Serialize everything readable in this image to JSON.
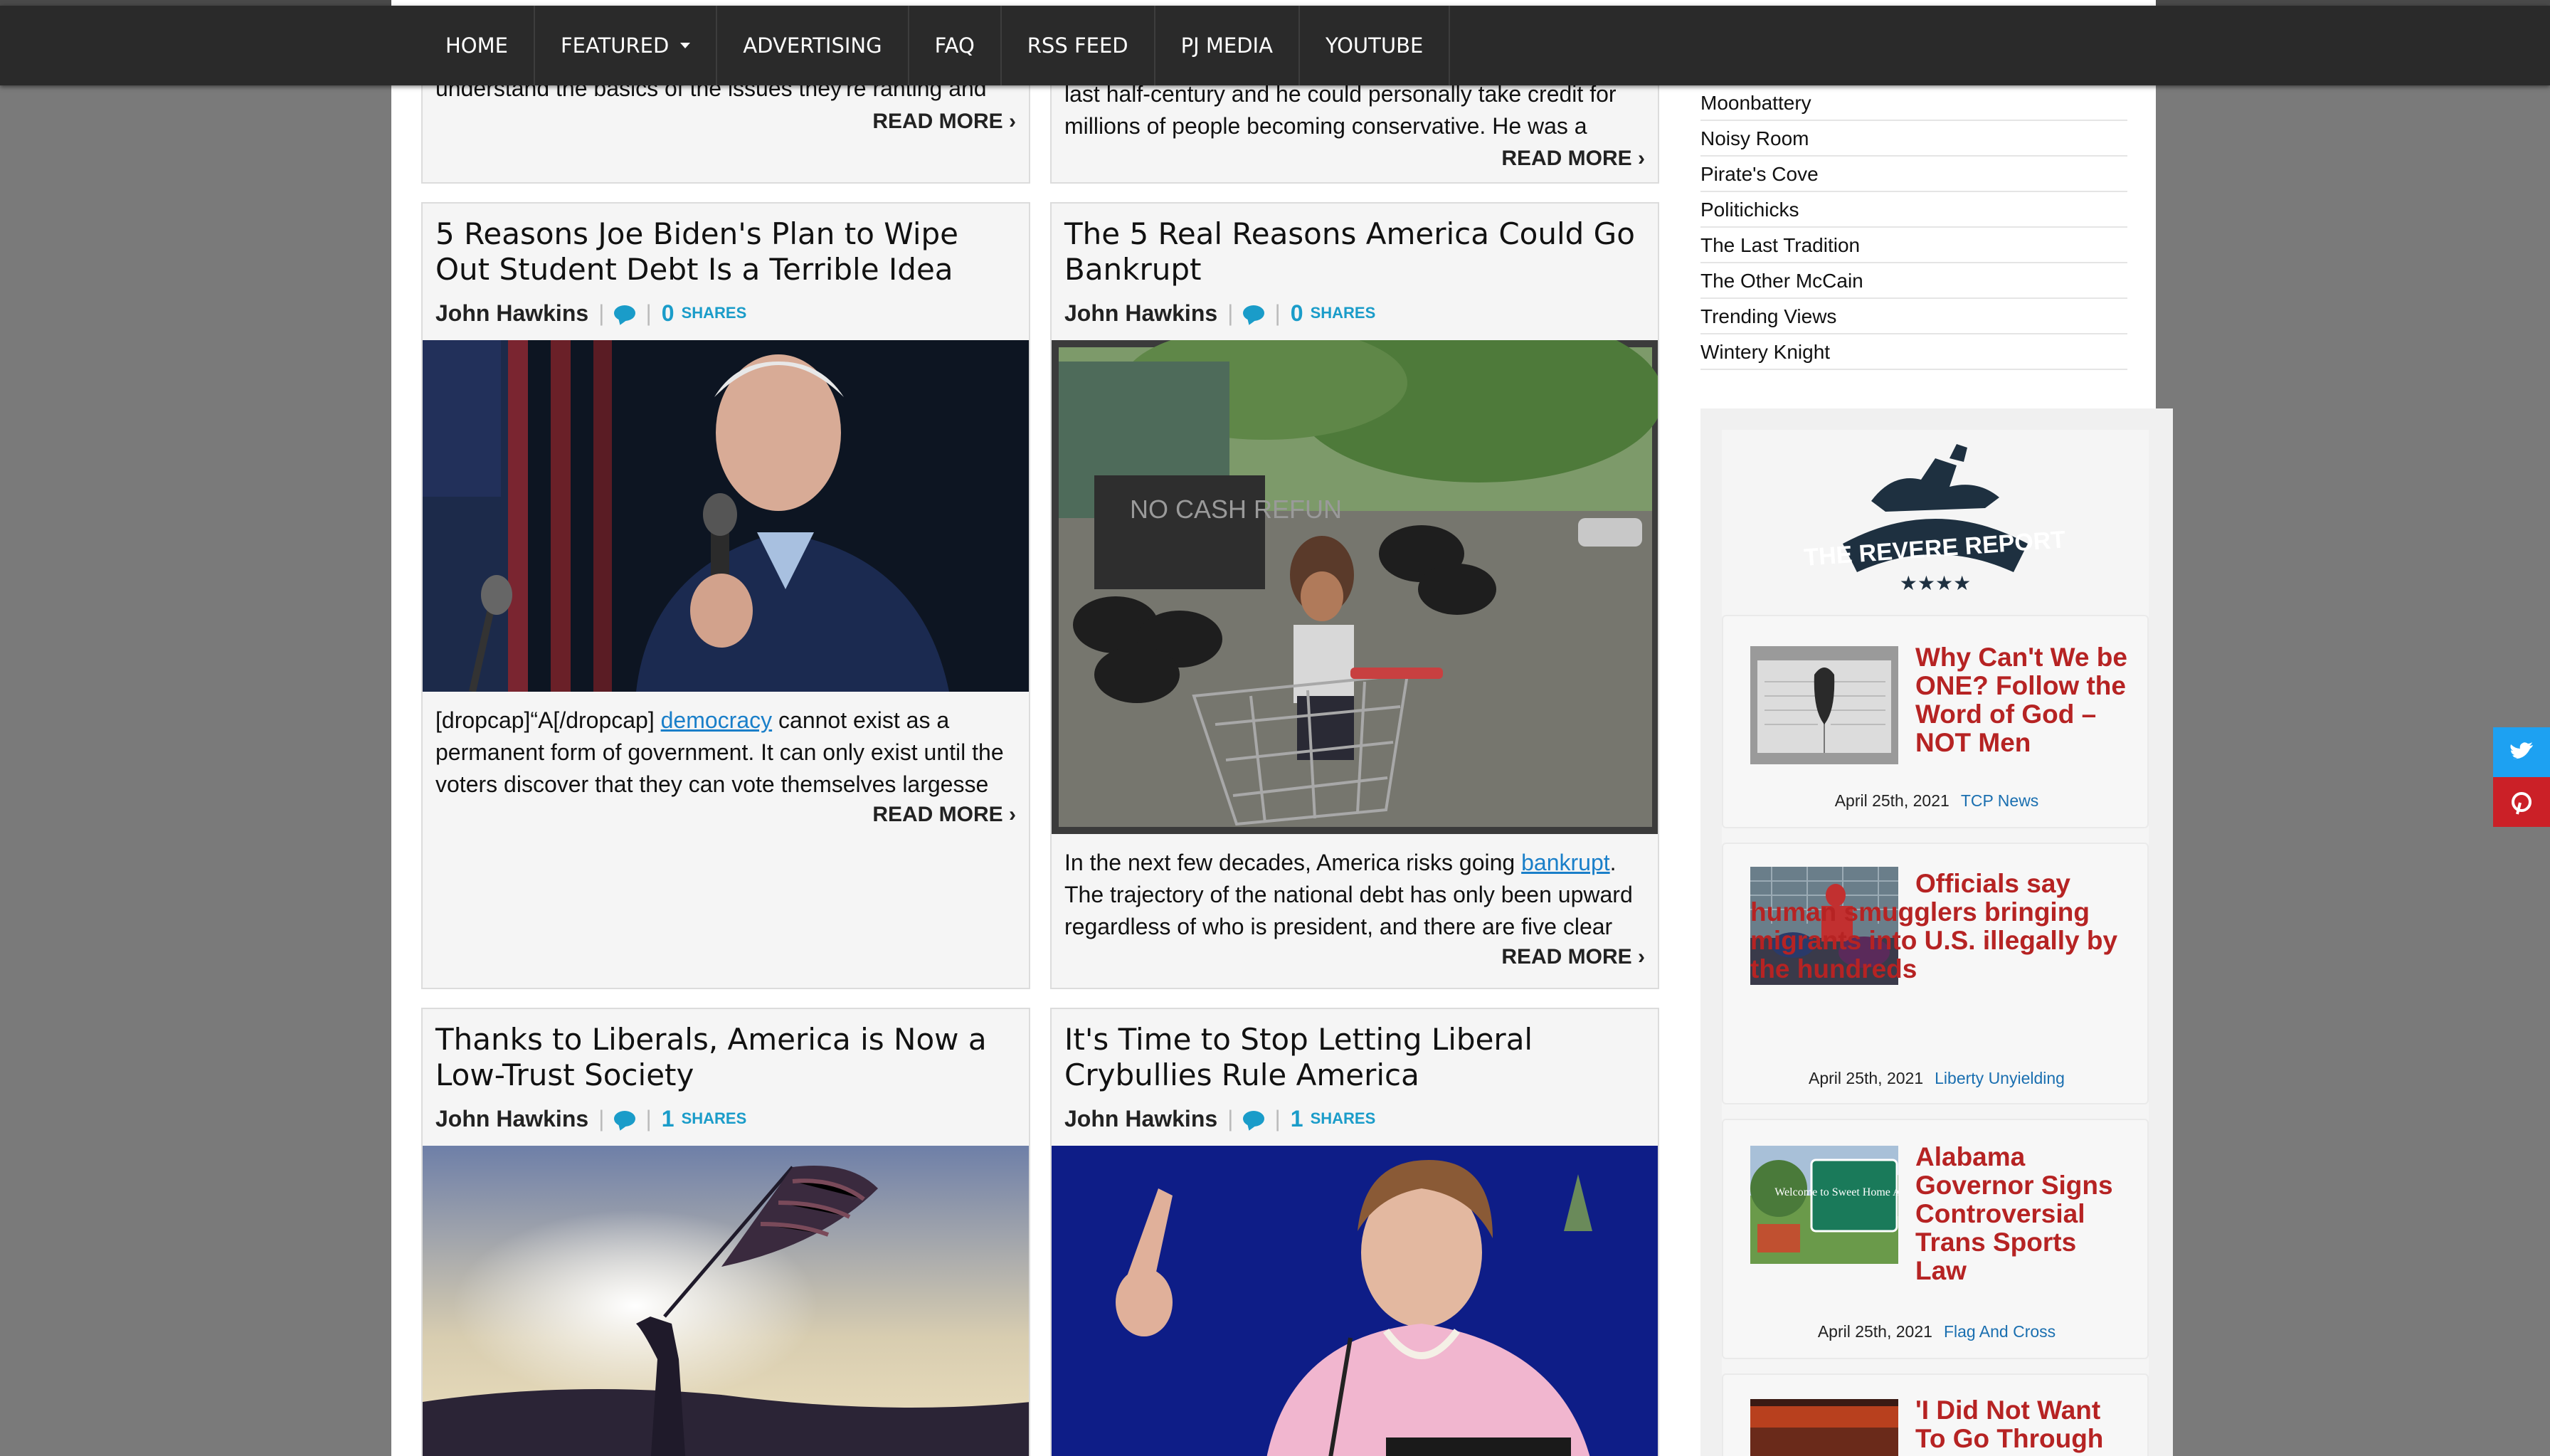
{
  "nav": {
    "items": [
      {
        "label": "HOME"
      },
      {
        "label": "FEATURED"
      },
      {
        "label": "ADVERTISING"
      },
      {
        "label": "FAQ"
      },
      {
        "label": "RSS FEED"
      },
      {
        "label": "PJ MEDIA"
      },
      {
        "label": "YOUTUBE"
      }
    ]
  },
  "posts": {
    "top_left": {
      "excerpt_fragment": "understand the basics of the issues they're ranting and",
      "read_more": "READ MORE"
    },
    "top_right": {
      "excerpt_line1": "last half-century and he could personally take credit for",
      "excerpt_line2": "millions of people becoming conservative. He was a",
      "read_more": "READ MORE"
    },
    "p1": {
      "title": "5 Reasons Joe Biden's Plan to Wipe Out Student Debt Is a Terrible Idea",
      "author": "John Hawkins",
      "share_count": "0",
      "shares_label": "SHARES",
      "excerpt_pre": "[dropcap]“A[/dropcap] ",
      "excerpt_link": "democracy",
      "excerpt_post": " cannot exist as a permanent form of government. It can only exist until the voters discover that they can vote themselves largesse",
      "read_more": "READ MORE"
    },
    "p2": {
      "title": "The 5 Real Reasons America Could Go Bankrupt",
      "author": "John Hawkins",
      "share_count": "0",
      "shares_label": "SHARES",
      "excerpt_pre": "In the next few decades, America risks going ",
      "excerpt_link": "bankrupt",
      "excerpt_post": ". The trajectory of the national debt has only been upward regardless of who is president, and there are five clear",
      "read_more": "READ MORE",
      "image_sign_text": "NO CASH REFUN"
    },
    "p3": {
      "title": "Thanks to Liberals, America is Now a Low-Trust Society",
      "author": "John Hawkins",
      "share_count": "1",
      "shares_label": "SHARES"
    },
    "p4": {
      "title": "It's Time to Stop Letting Liberal Crybullies Rule America",
      "author": "John Hawkins",
      "share_count": "1",
      "shares_label": "SHARES"
    }
  },
  "sidebar": {
    "links": [
      "Moonbattery",
      "Noisy Room",
      "Pirate's Cove",
      "Politichicks",
      "The Last Tradition",
      "The Other McCain",
      "Trending Views",
      "Wintery Knight"
    ]
  },
  "revere": {
    "logo_text": "THE REVERE REPORT",
    "logo_stars": "★★★★",
    "items": [
      {
        "title": "Why Can't We be ONE? Follow the Word of God – NOT Men",
        "date": "April 25th, 2021",
        "source": "TCP News"
      },
      {
        "title": "Officials say human smugglers bringing migrants into U.S. illegally by the hundreds",
        "date": "April 25th, 2021",
        "source": "Liberty Unyielding"
      },
      {
        "title": "Alabama Governor Signs Controversial Trans Sports Law",
        "date": "April 25th, 2021",
        "source": "Flag And Cross",
        "thumb_sign": "Welcome to Sweet Home Alabama"
      },
      {
        "title": "'I Did Not Want To Go Through"
      }
    ]
  },
  "colors": {
    "nav_bg": "#2a2a2a",
    "accent_blue": "#1a9cc9",
    "headline_red": "#b62323",
    "twitter": "#1da1f2",
    "pinterest": "#cb2027"
  },
  "icons": {
    "comment": "comment-bubble-icon",
    "twitter": "twitter-icon",
    "pinterest": "pinterest-icon",
    "dropdown": "chevron-down-icon"
  }
}
